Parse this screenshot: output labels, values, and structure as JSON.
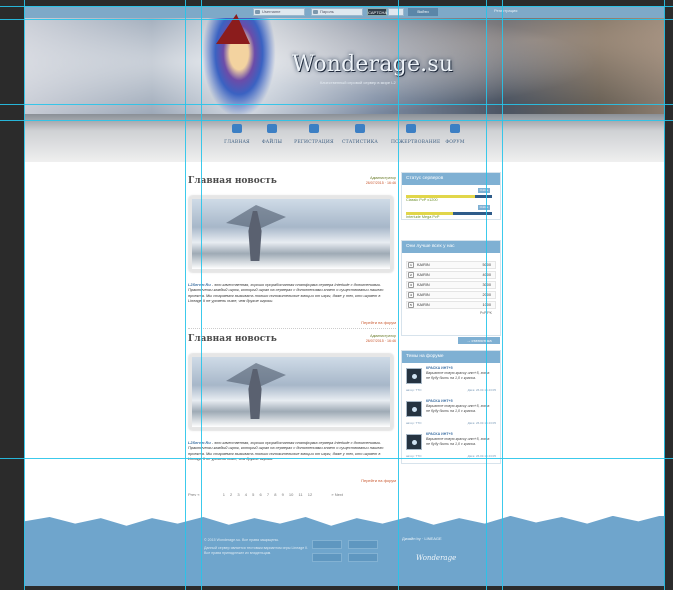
{
  "login": {
    "username_placeholder": "Username",
    "password_placeholder": "Пароль",
    "captcha": "CAPTCHA",
    "submit": "Войти",
    "register": "Регистрация"
  },
  "header": {
    "logo": "Wonderage.su",
    "slogan": "Качественный игровой сервер в мире L2"
  },
  "nav": [
    {
      "label": "ГЛАВНАЯ",
      "icon": "home-icon"
    },
    {
      "label": "ФАЙЛЫ",
      "icon": "files-icon"
    },
    {
      "label": "РЕГИСТРАЦИЯ",
      "icon": "user-icon"
    },
    {
      "label": "СТАТИСТИКА",
      "icon": "chart-icon"
    },
    {
      "label": "ПОЖЕРТВОВАНИЕ",
      "icon": "donate-icon"
    },
    {
      "label": "ФОРУМ",
      "icon": "forum-icon"
    }
  ],
  "posts": [
    {
      "title": "Главная новость",
      "author": "Администратор",
      "date": "26/07/2015 · 16:46",
      "body_lead": "L2Server.Ru",
      "body": " - это качественная, хорошо проработанная платформа сервера Interlude с дополнениями. Практически каждый игрок, который играл на серверах с дополнениями знает о существовании нашего проекта. Мы стараемся вызывать только положительные эмоции от игры, даже у тех, кто играет в Lineage II не уровень ниже, чем другие игроки.",
      "more": "Перейти на форум"
    },
    {
      "title": "Главная новость",
      "author": "Администратор",
      "date": "26/07/2015 · 16:46",
      "body_lead": "L2Server.Ru",
      "body": " - это качественная, хорошо проработанная платформа сервера Interlude с дополнениями. Практически каждый игрок, который играл на серверах с дополнениями знает о существовании нашего проекта. Мы стараемся вызывать только положительные эмоции от игры, даже у тех, кто играет в Lineage II не уровень ниже, чем другие игроки.",
      "more": "Перейти на форум"
    }
  ],
  "pager": {
    "prev": "Prev «",
    "pages": [
      "1",
      "2",
      "3",
      "4",
      "5",
      "6",
      "7",
      "8",
      "9",
      "10",
      "11",
      "12"
    ],
    "next": "» Next"
  },
  "sidebar": {
    "status_title": "Статус серверов",
    "servers": [
      {
        "name": "Classic PvP x1200",
        "status": "Online",
        "load": 0.8
      },
      {
        "name": "Interlude Mega PvP",
        "status": "Online",
        "load": 0.55
      }
    ],
    "top_title": "Они лучше всех у нас",
    "top": [
      {
        "rank": "1",
        "name": "KAIRIN",
        "value": "5000"
      },
      {
        "rank": "2",
        "name": "KAIRIN",
        "value": "4000"
      },
      {
        "rank": "3",
        "name": "KAIRIN",
        "value": "3000"
      },
      {
        "rank": "4",
        "name": "KAIRIN",
        "value": "2000"
      },
      {
        "rank": "5",
        "name": "KAIRIN",
        "value": "1000"
      }
    ],
    "top_caption": "PvP/PK",
    "all_stats": "→ статистика",
    "forum_title": "Темы на форуме",
    "topics": [
      {
        "title": "КРАСКА ИНТ+5",
        "text": "Варианте новую краску инт+5, хота не буду быть на 1,0 с краска.",
        "author": "автор: TTO",
        "date": "Дата: 26.03.15 23:05"
      },
      {
        "title": "КРАСКА ИНТ+5",
        "text": "Варианте новую краску инт+5, хота не буду быть на 1,0 с краска.",
        "author": "автор: TTO",
        "date": "Дата: 26.03.15 23:05"
      },
      {
        "title": "КРАСКА ИНТ+5",
        "text": "Варианте новую краску инт+5, хота не буду быть на 1,0 с краска.",
        "author": "автор: TTO",
        "date": "Дата: 26.03.15 23:05"
      }
    ]
  },
  "footer": {
    "copyright": "© 2015 Wonderage.su. Все права защищены.",
    "disclaimer": "Данный сервер является тестовым вариантом игры Lineage II. Все права принадлежат их владельцам.",
    "dev": "Дизайн by · LINEAGE",
    "signature": "Wonderage"
  },
  "colors": {
    "accent": "#7fb0d3",
    "guide": "#27c4ea",
    "orange": "#c9582f"
  }
}
